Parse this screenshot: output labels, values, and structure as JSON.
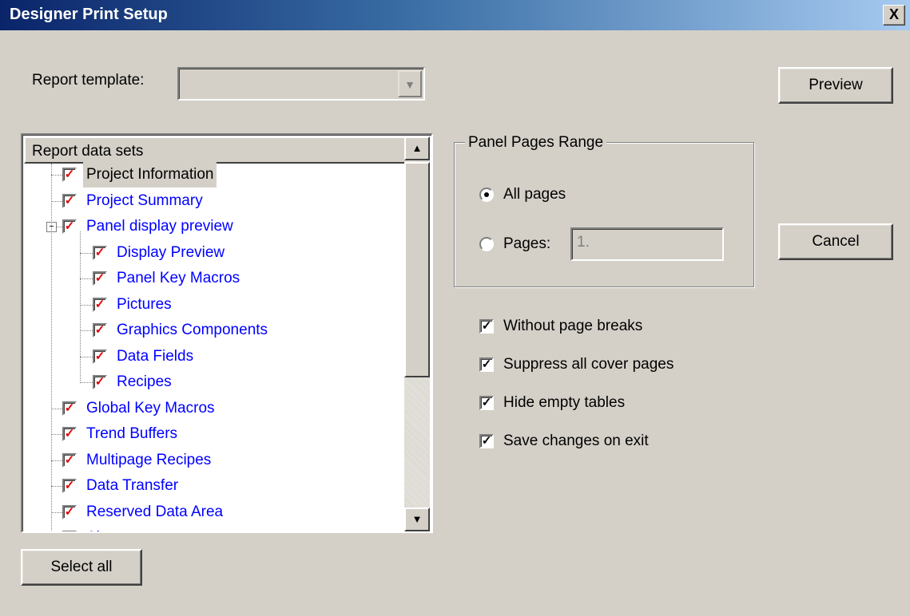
{
  "window": {
    "title": "Designer Print Setup",
    "close_label": "X"
  },
  "template": {
    "label": "Report template:",
    "value": ""
  },
  "buttons": {
    "preview": "Preview",
    "cancel": "Cancel",
    "select_all": "Select all"
  },
  "tree": {
    "header": "Report data sets",
    "items": [
      {
        "label": "Project Information",
        "checked": true,
        "level": 0,
        "selected": true
      },
      {
        "label": "Project Summary",
        "checked": true,
        "level": 0
      },
      {
        "label": "Panel display preview",
        "checked": true,
        "level": 0,
        "expanded": true
      },
      {
        "label": "Display Preview",
        "checked": true,
        "level": 1
      },
      {
        "label": "Panel Key Macros",
        "checked": true,
        "level": 1
      },
      {
        "label": "Pictures",
        "checked": true,
        "level": 1
      },
      {
        "label": "Graphics Components",
        "checked": true,
        "level": 1
      },
      {
        "label": "Data Fields",
        "checked": true,
        "level": 1
      },
      {
        "label": "Recipes",
        "checked": true,
        "level": 1
      },
      {
        "label": "Global Key Macros",
        "checked": true,
        "level": 0
      },
      {
        "label": "Trend Buffers",
        "checked": true,
        "level": 0
      },
      {
        "label": "Multipage Recipes",
        "checked": true,
        "level": 0
      },
      {
        "label": "Data Transfer",
        "checked": true,
        "level": 0
      },
      {
        "label": "Reserved Data Area",
        "checked": true,
        "level": 0
      },
      {
        "label": "Alarms",
        "checked": true,
        "level": 0
      }
    ]
  },
  "page_range": {
    "title": "Panel Pages Range",
    "all_pages": "All pages",
    "pages": "Pages:",
    "pages_value": "1.",
    "selected": "all"
  },
  "options": [
    {
      "label": "Without page breaks",
      "checked": true
    },
    {
      "label": "Suppress all cover pages",
      "checked": true
    },
    {
      "label": "Hide empty tables",
      "checked": true
    },
    {
      "label": "Save changes on exit",
      "checked": true
    }
  ]
}
